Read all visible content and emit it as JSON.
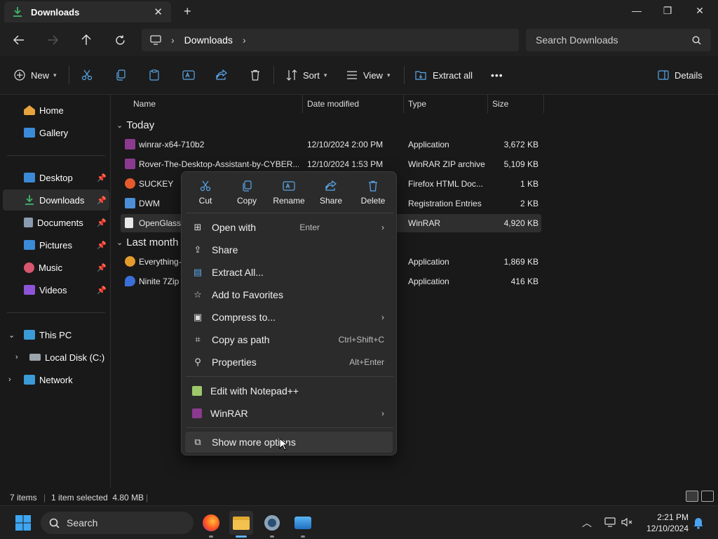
{
  "window": {
    "tab_title": "Downloads",
    "tab_close": "✕",
    "new_tab": "+",
    "minimize": "—",
    "restore": "❐",
    "close": "✕"
  },
  "address": {
    "crumbs": [
      "Downloads"
    ],
    "search_placeholder": "Search Downloads"
  },
  "toolbar": {
    "new_label": "New",
    "sort_label": "Sort",
    "view_label": "View",
    "extract_all_label": "Extract all",
    "more_label": "•••",
    "details_label": "Details"
  },
  "sidebar": {
    "items": [
      {
        "label": "Home",
        "icon": "home-icon",
        "color": "#e8a33d"
      },
      {
        "label": "Gallery",
        "icon": "gallery-icon",
        "color": "#3b8ad8"
      },
      {
        "label": "Desktop",
        "icon": "desktop-icon",
        "color": "#3b8ad8"
      },
      {
        "label": "Downloads",
        "icon": "download-icon",
        "color": "#3fb56b"
      },
      {
        "label": "Documents",
        "icon": "documents-icon",
        "color": "#8a9bb0"
      },
      {
        "label": "Pictures",
        "icon": "pictures-icon",
        "color": "#3b8ad8"
      },
      {
        "label": "Music",
        "icon": "music-icon",
        "color": "#d8566f"
      },
      {
        "label": "Videos",
        "icon": "videos-icon",
        "color": "#8d54d8"
      },
      {
        "label": "This PC",
        "icon": "pc-icon",
        "color": "#3b9ad8"
      },
      {
        "label": "Local Disk (C:)",
        "icon": "disk-icon",
        "color": "#9aa4ad"
      },
      {
        "label": "Network",
        "icon": "network-icon",
        "color": "#3b9ad8"
      }
    ]
  },
  "columns": {
    "name": "Name",
    "date": "Date modified",
    "type": "Type",
    "size": "Size"
  },
  "groups": {
    "today": "Today",
    "last_month": "Last month"
  },
  "files": [
    {
      "name": "winrar-x64-710b2",
      "date": "12/10/2024 2:00 PM",
      "type": "Application",
      "size": "3,672 KB",
      "icon_color": "#8b3a8f"
    },
    {
      "name": "Rover-The-Desktop-Assistant-by-CYBER...",
      "date": "12/10/2024 1:53 PM",
      "type": "WinRAR ZIP archive",
      "size": "5,109 KB",
      "icon_color": "#8b3a8f"
    },
    {
      "name": "SUCKEY",
      "date": "",
      "type": "Firefox HTML Doc...",
      "size": "1 KB",
      "icon_color": "#e55b2d"
    },
    {
      "name": "DWM",
      "date": "",
      "type": "Registration Entries",
      "size": "2 KB",
      "icon_color": "#4c8fd6"
    },
    {
      "name": "OpenGlass.",
      "date": "",
      "type": "WinRAR",
      "size": "4,920 KB",
      "icon_color": "#e9e9e9"
    },
    {
      "name": "Everything-",
      "date": "",
      "type": "Application",
      "size": "1,869 KB",
      "icon_color": "#e39b2b"
    },
    {
      "name": "Ninite 7Zip",
      "date": "",
      "type": "Application",
      "size": "416 KB",
      "icon_color": "#3b6fd8"
    }
  ],
  "context_menu": {
    "quick": [
      {
        "label": "Cut",
        "icon": "cut-icon"
      },
      {
        "label": "Copy",
        "icon": "copy-icon"
      },
      {
        "label": "Rename",
        "icon": "rename-icon"
      },
      {
        "label": "Share",
        "icon": "share-icon"
      },
      {
        "label": "Delete",
        "icon": "delete-icon"
      }
    ],
    "items": [
      {
        "label": "Open with",
        "shortcut": "Enter",
        "submenu": true,
        "icon": "open-with-icon"
      },
      {
        "label": "Share",
        "shortcut": "",
        "submenu": false,
        "icon": "share-icon"
      },
      {
        "label": "Extract All...",
        "shortcut": "",
        "submenu": false,
        "icon": "extract-icon"
      },
      {
        "label": "Add to Favorites",
        "shortcut": "",
        "submenu": false,
        "icon": "star-icon"
      },
      {
        "label": "Compress to...",
        "shortcut": "",
        "submenu": true,
        "icon": "compress-icon"
      },
      {
        "label": "Copy as path",
        "shortcut": "Ctrl+Shift+C",
        "submenu": false,
        "icon": "path-icon"
      },
      {
        "label": "Properties",
        "shortcut": "Alt+Enter",
        "submenu": false,
        "icon": "wrench-icon"
      },
      {
        "label": "Edit with Notepad++",
        "shortcut": "",
        "submenu": false,
        "icon": "notepad-icon"
      },
      {
        "label": "WinRAR",
        "shortcut": "",
        "submenu": true,
        "icon": "winrar-icon"
      },
      {
        "label": "Show more options",
        "shortcut": "",
        "submenu": false,
        "icon": "more-options-icon"
      }
    ]
  },
  "status": {
    "count": "7 items",
    "selected": "1 item selected  4.80 MB"
  },
  "taskbar": {
    "search_placeholder": "Search",
    "time": "2:21 PM",
    "date": "12/10/2024"
  }
}
